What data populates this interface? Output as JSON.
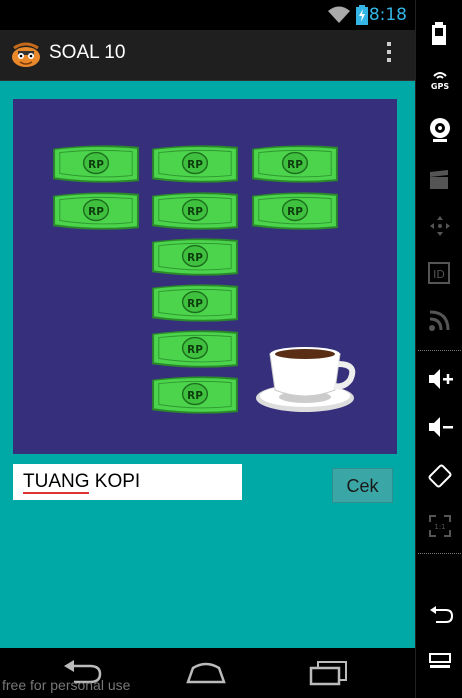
{
  "status_bar": {
    "time": "8:18"
  },
  "action_bar": {
    "title": "SOAL 10"
  },
  "puzzle": {
    "bill_label": "RP",
    "icons": [
      "money-bill-icon",
      "coffee-cup-icon"
    ]
  },
  "answer": {
    "value": "TUANG KOPI",
    "check_label": "Cek"
  },
  "watermark": "free for personal use",
  "side_panel": {
    "gps_label": "GPS",
    "id_label": "ID",
    "ratio_label": "1:1"
  },
  "colors": {
    "content_bg": "#00a9a5",
    "puzzle_bg": "#36307c",
    "bill_green": "#4cd44c",
    "accent_blue": "#33b5e5"
  }
}
